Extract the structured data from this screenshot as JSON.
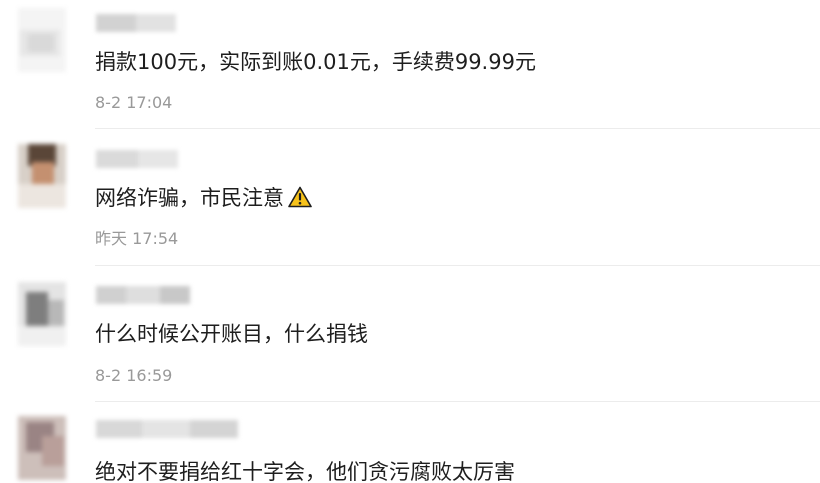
{
  "comments": [
    {
      "text": "捐款100元，实际到账0.01元，手续费99.99元",
      "time": "8-2 17:04"
    },
    {
      "text": "网络诈骗，市民注意",
      "emoji": "warning-icon",
      "time": "昨天 17:54"
    },
    {
      "text": "什么时候公开账目，什么捐钱",
      "time": "8-2 16:59"
    },
    {
      "text": "绝对不要捐给红十字会，他们贪污腐败太厉害",
      "time": ""
    }
  ],
  "colors": {
    "text": "#1e1e1e",
    "time": "#999999",
    "divider": "#ececec",
    "warning_fill": "#f7c21a"
  }
}
